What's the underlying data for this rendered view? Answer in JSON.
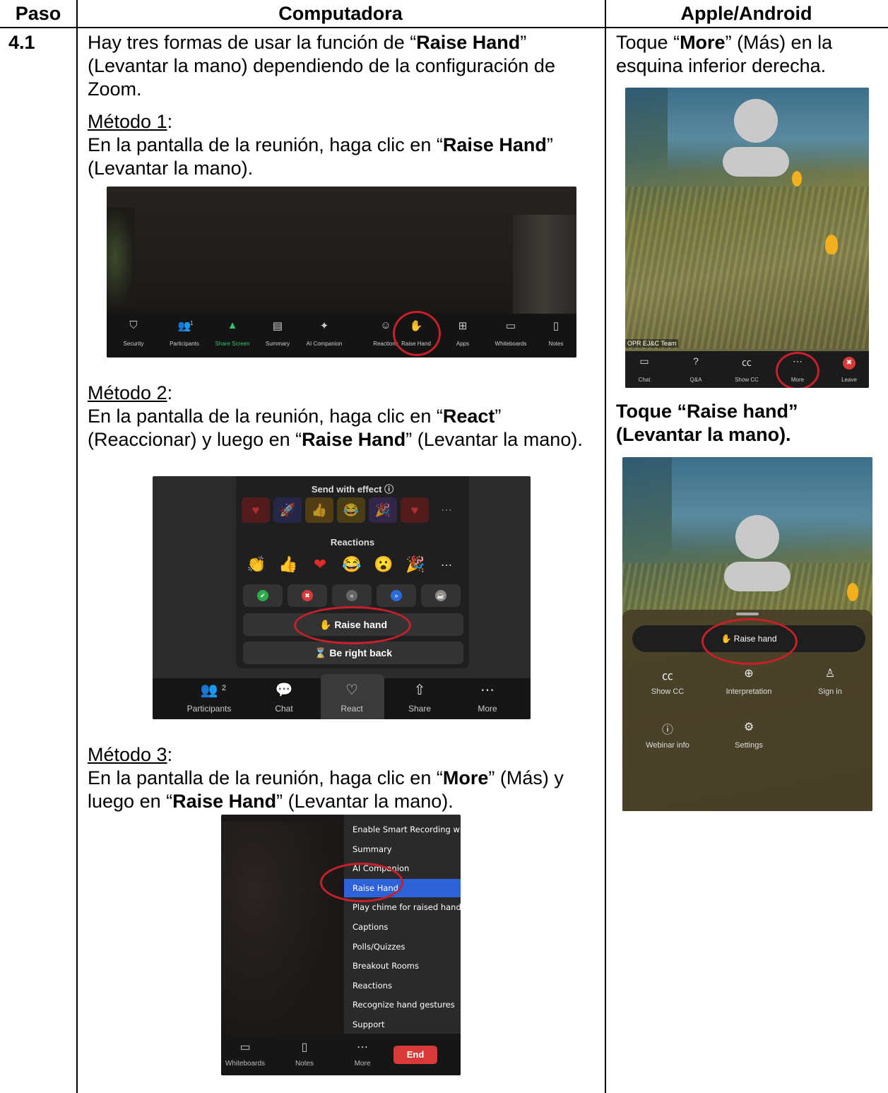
{
  "headers": {
    "step": "Paso",
    "computer": "Computadora",
    "mobile": "Apple/Android"
  },
  "step_number": "4.1",
  "intro": {
    "a": "Hay tres formas de usar la función de “",
    "b": "Raise Hand",
    "c": "” (Levantar la mano) dependiendo de la configuración de Zoom."
  },
  "m1": {
    "title": "Método 1",
    "colon": ":",
    "a": "En la pantalla de la reunión, haga clic en “",
    "b": "Raise Hand",
    "c": "” (Levantar la mano)."
  },
  "m2": {
    "title": "Método 2",
    "colon": ":",
    "a": "En la pantalla de la reunión, haga clic en “",
    "b": "React",
    "c": "” (Reaccionar) y luego en “",
    "d": "Raise Hand",
    "e": "” (Levantar la mano)."
  },
  "m3": {
    "title": "Método 3",
    "colon": ":",
    "a": "En la pantalla de la reunión, haga clic en “",
    "b": "More",
    "c": "” (Más) y luego en “",
    "d": "Raise Hand",
    "e": "” (Levantar la mano)."
  },
  "mob1": {
    "a": "Toque “",
    "b": "More",
    "c": "” (Más) en la esquina inferior derecha."
  },
  "mob2": {
    "a": "Toque “Raise hand” (Levantar la mano)."
  },
  "shot1_toolbar": [
    "Security",
    "Participants",
    "Share Screen",
    "Summary",
    "AI Companion",
    "Reactions",
    "Raise Hand",
    "Apps",
    "Whiteboards",
    "Notes"
  ],
  "shot1_participant_count": "1",
  "shot2": {
    "send_with_effect": "Send with effect",
    "reactions": "Reactions",
    "raise_hand": "Raise hand",
    "be_right_back": "Be right back",
    "toolbar": [
      "Participants",
      "Chat",
      "React",
      "Share",
      "More"
    ],
    "participant_count": "2"
  },
  "shot3": {
    "menu": [
      "Enable Smart Recording wi",
      "Summary",
      "AI Companion",
      "Raise Hand",
      "Play chime for raised hand",
      "Captions",
      "Polls/Quizzes",
      "Breakout Rooms",
      "Reactions",
      "Recognize hand gestures",
      "Support"
    ],
    "toolbar": [
      "Whiteboards",
      "Notes",
      "More"
    ],
    "end": "End"
  },
  "mshot1": {
    "team": "OPR EJ&C Team",
    "toolbar": [
      "Chat",
      "Q&A",
      "Show CC",
      "More",
      "Leave"
    ]
  },
  "mshot2": {
    "raise_hand": "Raise hand",
    "row1": [
      "Show CC",
      "Interpretation",
      "Sign in"
    ],
    "row2": [
      "Webinar info",
      "Settings"
    ]
  }
}
